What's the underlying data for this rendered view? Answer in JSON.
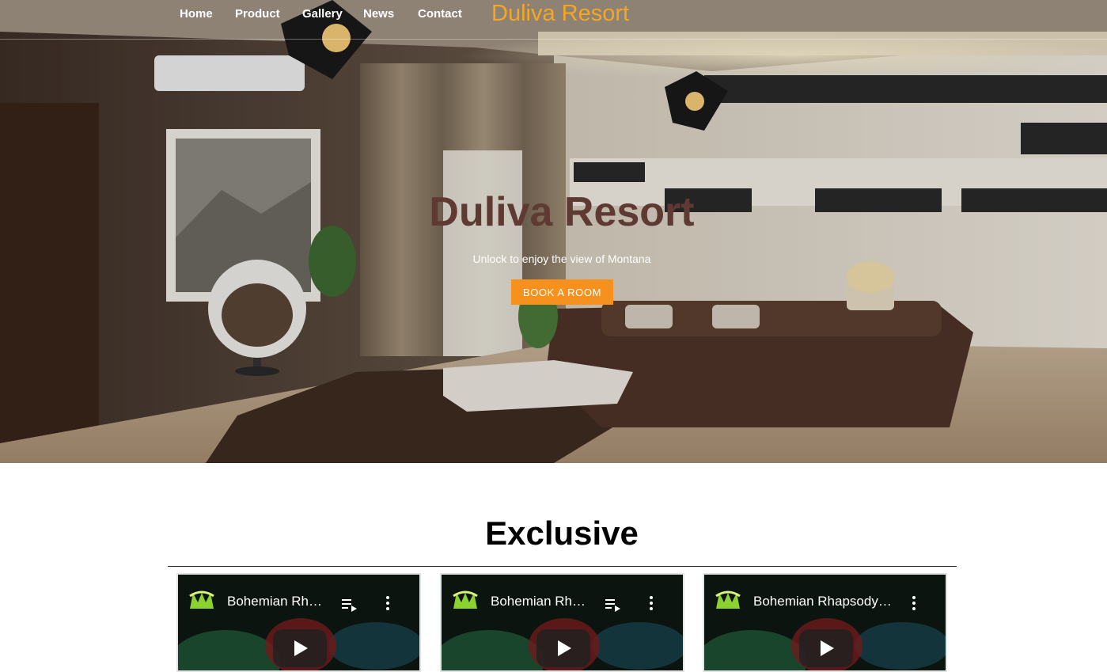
{
  "nav": {
    "items": [
      "Home",
      "Product",
      "Gallery",
      "News",
      "Contact"
    ],
    "brand": "Duliva Resort"
  },
  "hero": {
    "title": "Duliva Resort",
    "subtitle": "Unlock to enjoy the view of Montana",
    "button_label": "BOOK A ROOM",
    "image": "living-room-interior"
  },
  "exclusive": {
    "title": "Exclusive",
    "videos": [
      {
        "title": "Bohemian Rh…",
        "icons": [
          "channel-logo-icon",
          "queue-icon",
          "more-vert-icon",
          "play-icon"
        ]
      },
      {
        "title": "Bohemian Rh…",
        "icons": [
          "channel-logo-icon",
          "queue-icon",
          "more-vert-icon",
          "play-icon"
        ]
      },
      {
        "title": "Bohemian Rhapsody…",
        "icons": [
          "channel-logo-icon",
          "queue-icon",
          "more-vert-icon",
          "play-icon"
        ]
      }
    ]
  },
  "colors": {
    "brand": "#f5a623",
    "button": "#f7911e",
    "hero_title": "#5e3a33",
    "section_title": "#000000"
  }
}
